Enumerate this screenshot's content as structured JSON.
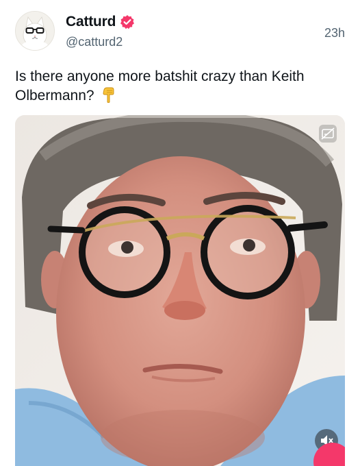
{
  "author": {
    "display_name": "Catturd",
    "handle": "@catturd2",
    "verified": true,
    "avatar_icon": "cat-with-glasses-avatar"
  },
  "tweet": {
    "timestamp": "23h",
    "text": "Is there anyone more batshit crazy than Keith Olbermann?",
    "emoji": "pointing-down-hand-emoji"
  },
  "media": {
    "type": "video",
    "caption_icon": "closed-captions-icon",
    "mute_icon": "speaker-muted-icon"
  },
  "colors": {
    "verified_badge": "#f4386a",
    "secondary_text": "#536471",
    "action_fab": "#f4386a"
  }
}
